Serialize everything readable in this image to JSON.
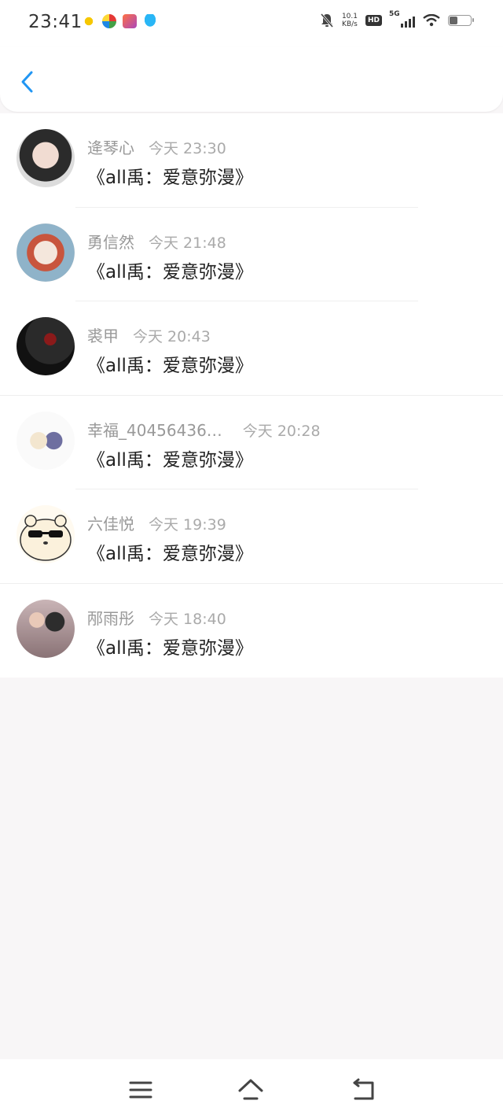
{
  "status_bar": {
    "time": "23:41",
    "net_speed_value": "10.1",
    "net_speed_unit": "KB/s",
    "hd_badge": "HD",
    "network": "5G",
    "battery_level": 0.4
  },
  "header": {
    "back_icon": "chevron-left-icon",
    "accent_color": "#2196f3"
  },
  "messages": [
    {
      "name": "逄琴心",
      "time": "今天 23:30",
      "text": "《all禹：爱意弥漫》"
    },
    {
      "name": "勇信然",
      "time": "今天 21:48",
      "text": "《all禹：爱意弥漫》"
    },
    {
      "name": "裘甲",
      "time": "今天 20:43",
      "text": "《all禹：爱意弥漫》"
    },
    {
      "name": "幸福_40456436…",
      "time": "今天 20:28",
      "text": "《all禹：爱意弥漫》"
    },
    {
      "name": "六佳悦",
      "time": "今天 19:39",
      "text": "《all禹：爱意弥漫》"
    },
    {
      "name": "邴雨彤",
      "time": "今天 18:40",
      "text": "《all禹：爱意弥漫》"
    }
  ],
  "nav_bar": {
    "icons": [
      "menu-icon",
      "home-icon",
      "back-icon"
    ]
  }
}
